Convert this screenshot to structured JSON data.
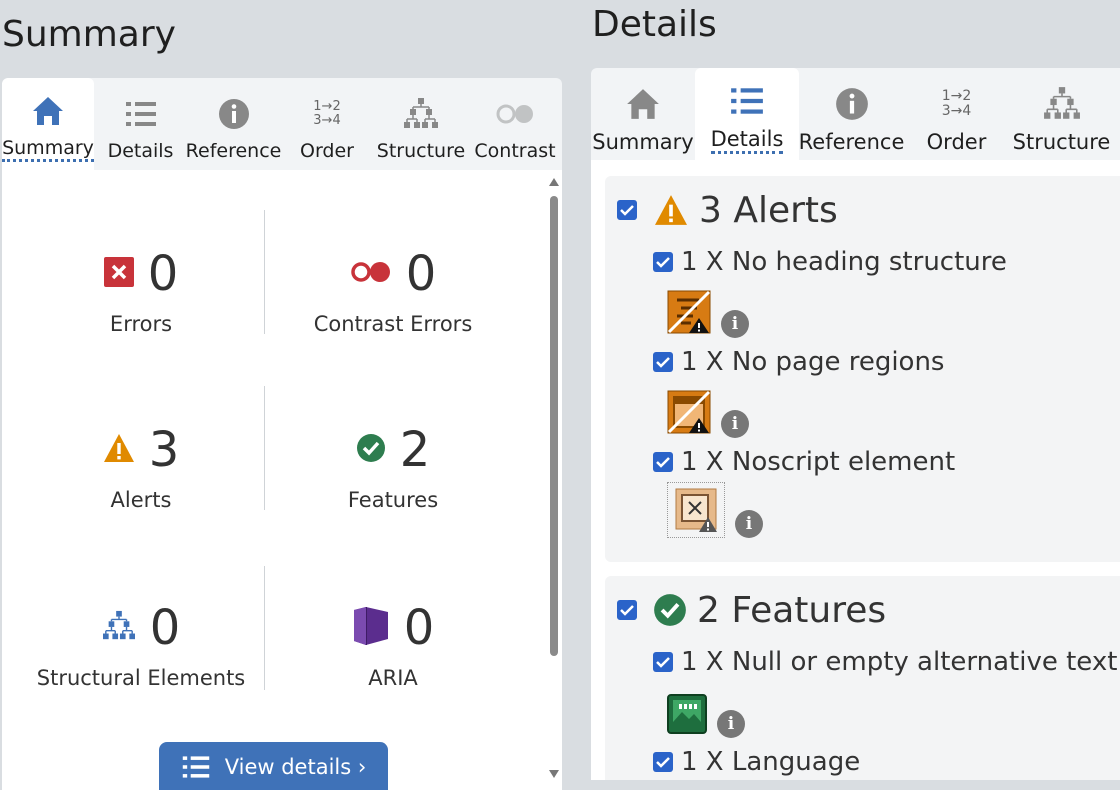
{
  "summary_panel": {
    "title": "Summary",
    "tabs": [
      {
        "label": "Summary",
        "icon": "home-icon",
        "active": true
      },
      {
        "label": "Details",
        "icon": "list-icon"
      },
      {
        "label": "Reference",
        "icon": "info-icon"
      },
      {
        "label": "Order",
        "icon": "order-icon",
        "order_top": "1→2",
        "order_bottom": "3→4"
      },
      {
        "label": "Structure",
        "icon": "structure-icon"
      },
      {
        "label": "Contrast",
        "icon": "contrast-icon",
        "disabled": true
      }
    ],
    "stats": [
      {
        "label": "Errors",
        "value": "0",
        "icon": "error-icon",
        "color": "#c8333a"
      },
      {
        "label": "Contrast Errors",
        "value": "0",
        "icon": "contrast-error-icon",
        "color": "#c8333a"
      },
      {
        "label": "Alerts",
        "value": "3",
        "icon": "alert-icon",
        "color": "#e08a00"
      },
      {
        "label": "Features",
        "value": "2",
        "icon": "feature-icon",
        "color": "#2e7d4f"
      },
      {
        "label": "Structural Elements",
        "value": "0",
        "icon": "structure-icon",
        "color": "#3f72b8"
      },
      {
        "label": "ARIA",
        "value": "0",
        "icon": "aria-icon",
        "color": "#5b2d8e"
      }
    ],
    "view_details_label": "View details ›"
  },
  "details_panel": {
    "title": "Details",
    "tabs": [
      {
        "label": "Summary",
        "icon": "home-icon"
      },
      {
        "label": "Details",
        "icon": "list-icon",
        "active": true
      },
      {
        "label": "Reference",
        "icon": "info-icon"
      },
      {
        "label": "Order",
        "icon": "order-icon",
        "order_top": "1→2",
        "order_bottom": "3→4"
      },
      {
        "label": "Structure",
        "icon": "structure-icon"
      }
    ],
    "alerts": {
      "title": "3 Alerts",
      "items": [
        {
          "title": "1 X No heading structure",
          "icon": "no-heading-icon"
        },
        {
          "title": "1 X No page regions",
          "icon": "no-regions-icon"
        },
        {
          "title": "1 X Noscript element",
          "icon": "noscript-icon"
        }
      ]
    },
    "features": {
      "title": "2 Features",
      "items": [
        {
          "title": "1 X Null or empty alternative text",
          "icon": "empty-alt-icon"
        },
        {
          "title": "1 X Language",
          "icon": "language-icon"
        }
      ]
    }
  },
  "colors": {
    "accent": "#3f72b8",
    "checkbox": "#2a63c9",
    "alert": "#e08a00",
    "error": "#c8333a",
    "feature": "#2e7d4f",
    "aria": "#5b2d8e"
  }
}
